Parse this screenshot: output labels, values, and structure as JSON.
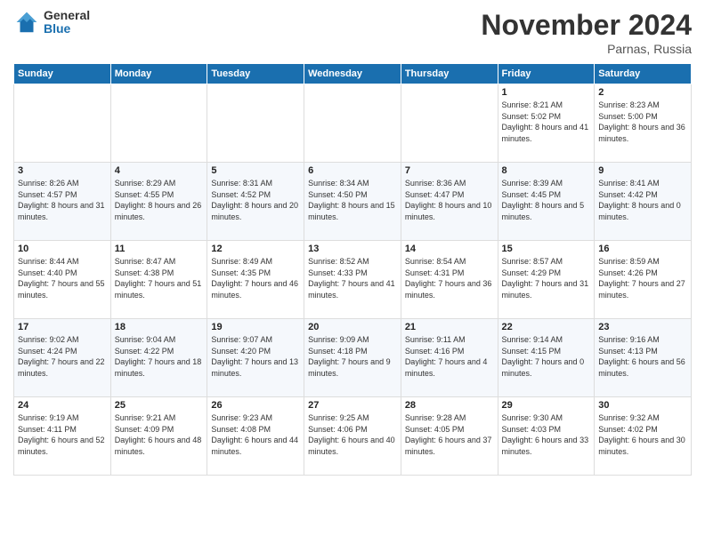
{
  "header": {
    "logo_general": "General",
    "logo_blue": "Blue",
    "month_title": "November 2024",
    "location": "Parnas, Russia"
  },
  "weekdays": [
    "Sunday",
    "Monday",
    "Tuesday",
    "Wednesday",
    "Thursday",
    "Friday",
    "Saturday"
  ],
  "weeks": [
    [
      {
        "day": "",
        "info": ""
      },
      {
        "day": "",
        "info": ""
      },
      {
        "day": "",
        "info": ""
      },
      {
        "day": "",
        "info": ""
      },
      {
        "day": "",
        "info": ""
      },
      {
        "day": "1",
        "info": "Sunrise: 8:21 AM\nSunset: 5:02 PM\nDaylight: 8 hours and 41 minutes."
      },
      {
        "day": "2",
        "info": "Sunrise: 8:23 AM\nSunset: 5:00 PM\nDaylight: 8 hours and 36 minutes."
      }
    ],
    [
      {
        "day": "3",
        "info": "Sunrise: 8:26 AM\nSunset: 4:57 PM\nDaylight: 8 hours and 31 minutes."
      },
      {
        "day": "4",
        "info": "Sunrise: 8:29 AM\nSunset: 4:55 PM\nDaylight: 8 hours and 26 minutes."
      },
      {
        "day": "5",
        "info": "Sunrise: 8:31 AM\nSunset: 4:52 PM\nDaylight: 8 hours and 20 minutes."
      },
      {
        "day": "6",
        "info": "Sunrise: 8:34 AM\nSunset: 4:50 PM\nDaylight: 8 hours and 15 minutes."
      },
      {
        "day": "7",
        "info": "Sunrise: 8:36 AM\nSunset: 4:47 PM\nDaylight: 8 hours and 10 minutes."
      },
      {
        "day": "8",
        "info": "Sunrise: 8:39 AM\nSunset: 4:45 PM\nDaylight: 8 hours and 5 minutes."
      },
      {
        "day": "9",
        "info": "Sunrise: 8:41 AM\nSunset: 4:42 PM\nDaylight: 8 hours and 0 minutes."
      }
    ],
    [
      {
        "day": "10",
        "info": "Sunrise: 8:44 AM\nSunset: 4:40 PM\nDaylight: 7 hours and 55 minutes."
      },
      {
        "day": "11",
        "info": "Sunrise: 8:47 AM\nSunset: 4:38 PM\nDaylight: 7 hours and 51 minutes."
      },
      {
        "day": "12",
        "info": "Sunrise: 8:49 AM\nSunset: 4:35 PM\nDaylight: 7 hours and 46 minutes."
      },
      {
        "day": "13",
        "info": "Sunrise: 8:52 AM\nSunset: 4:33 PM\nDaylight: 7 hours and 41 minutes."
      },
      {
        "day": "14",
        "info": "Sunrise: 8:54 AM\nSunset: 4:31 PM\nDaylight: 7 hours and 36 minutes."
      },
      {
        "day": "15",
        "info": "Sunrise: 8:57 AM\nSunset: 4:29 PM\nDaylight: 7 hours and 31 minutes."
      },
      {
        "day": "16",
        "info": "Sunrise: 8:59 AM\nSunset: 4:26 PM\nDaylight: 7 hours and 27 minutes."
      }
    ],
    [
      {
        "day": "17",
        "info": "Sunrise: 9:02 AM\nSunset: 4:24 PM\nDaylight: 7 hours and 22 minutes."
      },
      {
        "day": "18",
        "info": "Sunrise: 9:04 AM\nSunset: 4:22 PM\nDaylight: 7 hours and 18 minutes."
      },
      {
        "day": "19",
        "info": "Sunrise: 9:07 AM\nSunset: 4:20 PM\nDaylight: 7 hours and 13 minutes."
      },
      {
        "day": "20",
        "info": "Sunrise: 9:09 AM\nSunset: 4:18 PM\nDaylight: 7 hours and 9 minutes."
      },
      {
        "day": "21",
        "info": "Sunrise: 9:11 AM\nSunset: 4:16 PM\nDaylight: 7 hours and 4 minutes."
      },
      {
        "day": "22",
        "info": "Sunrise: 9:14 AM\nSunset: 4:15 PM\nDaylight: 7 hours and 0 minutes."
      },
      {
        "day": "23",
        "info": "Sunrise: 9:16 AM\nSunset: 4:13 PM\nDaylight: 6 hours and 56 minutes."
      }
    ],
    [
      {
        "day": "24",
        "info": "Sunrise: 9:19 AM\nSunset: 4:11 PM\nDaylight: 6 hours and 52 minutes."
      },
      {
        "day": "25",
        "info": "Sunrise: 9:21 AM\nSunset: 4:09 PM\nDaylight: 6 hours and 48 minutes."
      },
      {
        "day": "26",
        "info": "Sunrise: 9:23 AM\nSunset: 4:08 PM\nDaylight: 6 hours and 44 minutes."
      },
      {
        "day": "27",
        "info": "Sunrise: 9:25 AM\nSunset: 4:06 PM\nDaylight: 6 hours and 40 minutes."
      },
      {
        "day": "28",
        "info": "Sunrise: 9:28 AM\nSunset: 4:05 PM\nDaylight: 6 hours and 37 minutes."
      },
      {
        "day": "29",
        "info": "Sunrise: 9:30 AM\nSunset: 4:03 PM\nDaylight: 6 hours and 33 minutes."
      },
      {
        "day": "30",
        "info": "Sunrise: 9:32 AM\nSunset: 4:02 PM\nDaylight: 6 hours and 30 minutes."
      }
    ]
  ]
}
